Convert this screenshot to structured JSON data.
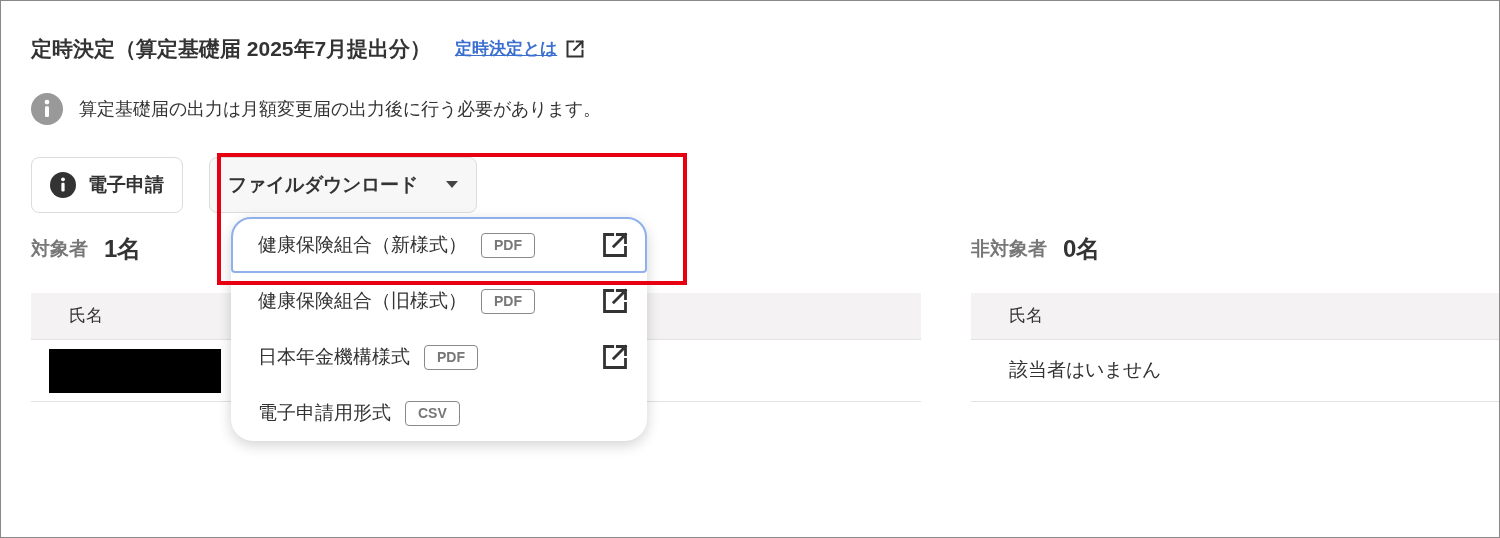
{
  "title": "定時決定（算定基礎届 2025年7月提出分）",
  "help_link": {
    "label": "定時決定とは"
  },
  "notice": "算定基礎届の出力は月額変更届の出力後に行う必要があります。",
  "buttons": [
    {
      "label": "電子申請",
      "kind": "info"
    },
    {
      "label": "ファイルダウンロード",
      "kind": "dropdown",
      "expanded": true
    }
  ],
  "menu": [
    {
      "label": "健康保険組合（新様式）",
      "format": "PDF",
      "external": true,
      "selected": true
    },
    {
      "label": "健康保険組合（旧様式）",
      "format": "PDF",
      "external": true,
      "selected": false
    },
    {
      "label": "日本年金機構様式",
      "format": "PDF",
      "external": true,
      "selected": false
    },
    {
      "label": "電子申請用形式",
      "format": "CSV",
      "external": false,
      "selected": false
    }
  ],
  "groups": [
    {
      "label": "対象者",
      "count": "1名",
      "columns": [
        "氏名"
      ],
      "rows": [
        {
          "kind": "redacted"
        }
      ]
    },
    {
      "label": "非対象者",
      "count": "0名",
      "columns": [
        "氏名"
      ],
      "rows": [
        {
          "kind": "text",
          "text": "該当者はいません"
        }
      ]
    }
  ]
}
